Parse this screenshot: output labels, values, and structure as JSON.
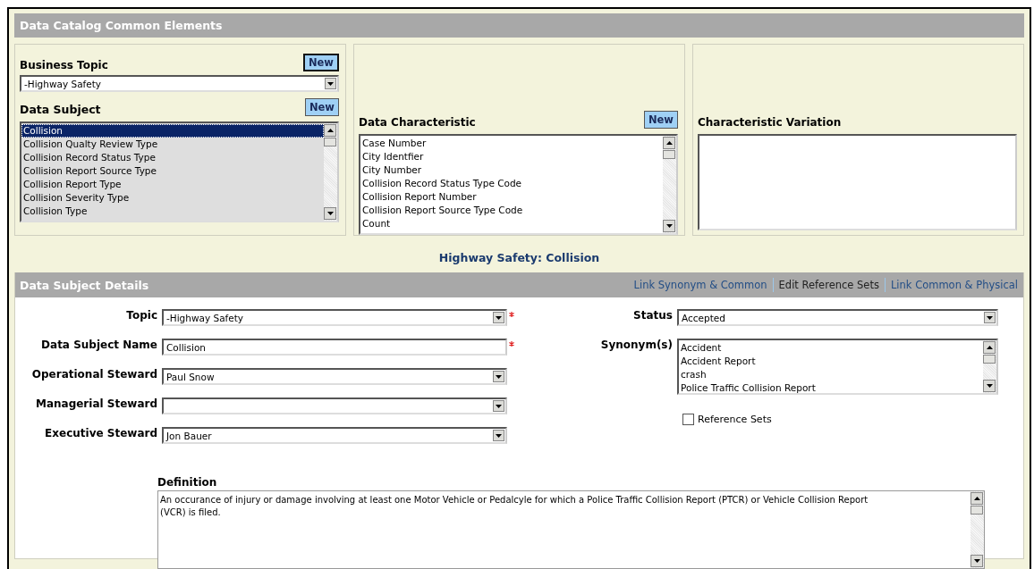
{
  "header": {
    "title": "Data Catalog Common Elements"
  },
  "business_topic": {
    "label": "Business Topic",
    "new_button": {
      "label": "New",
      "focused": true
    },
    "value": "-Highway Safety"
  },
  "data_subject": {
    "label": "Data Subject",
    "new_button": {
      "label": "New",
      "focused": false
    },
    "items": [
      {
        "text": "Collision",
        "selected": true
      },
      {
        "text": "Collision Qualty Review Type",
        "selected": false
      },
      {
        "text": "Collision Record Status Type",
        "selected": false
      },
      {
        "text": "Collision Report Source Type",
        "selected": false
      },
      {
        "text": "Collision Report Type",
        "selected": false
      },
      {
        "text": "Collision Severity Type",
        "selected": false
      },
      {
        "text": "Collision Type",
        "selected": false
      }
    ]
  },
  "data_characteristic": {
    "label": "Data Characteristic",
    "new_button": {
      "label": "New",
      "focused": false
    },
    "items": [
      {
        "text": "Case Number",
        "selected": false
      },
      {
        "text": "City Identfier",
        "selected": false
      },
      {
        "text": "City Number",
        "selected": false
      },
      {
        "text": "Collision Record Status Type Code",
        "selected": false
      },
      {
        "text": "Collision Report Number",
        "selected": false
      },
      {
        "text": "Collision Report Source Type Code",
        "selected": false
      },
      {
        "text": "Count",
        "selected": false
      }
    ]
  },
  "characteristic_variation": {
    "label": "Characteristic Variation"
  },
  "breadcrumb": "Highway Safety: Collision",
  "details": {
    "title": "Data Subject Details",
    "links": [
      {
        "label": "Link Synonym & Common",
        "kind": "link"
      },
      {
        "label": "Edit Reference Sets",
        "kind": "plain"
      },
      {
        "label": "Link Common & Physical",
        "kind": "link"
      }
    ],
    "left_fields": [
      {
        "label": "Topic",
        "kind": "select",
        "value": "-Highway Safety",
        "required": true
      },
      {
        "label": "Data Subject Name",
        "kind": "text",
        "value": "Collision",
        "required": true
      },
      {
        "label": "Operational Steward",
        "kind": "select",
        "value": "Paul Snow",
        "required": false
      },
      {
        "label": "Managerial Steward",
        "kind": "select",
        "required": false
      },
      {
        "label": "Executive Steward",
        "kind": "select",
        "value": "Jon Bauer",
        "required": false
      }
    ],
    "status": {
      "label": "Status",
      "value": "Accepted"
    },
    "synonyms": {
      "label": "Synonym(s)",
      "items": [
        "Accident",
        "Accident Report",
        "crash",
        "Police Traffic Collision Report"
      ]
    },
    "reference_sets": {
      "label": "Reference Sets",
      "checked": false
    },
    "definition": {
      "label": "Definition",
      "value": "An occurance of injury or damage involving at least one Motor Vehicle or Pedalcyle for which a Police Traffic Collision Report  (PTCR) or Vehicle Collision Report (VCR) is filed."
    }
  }
}
